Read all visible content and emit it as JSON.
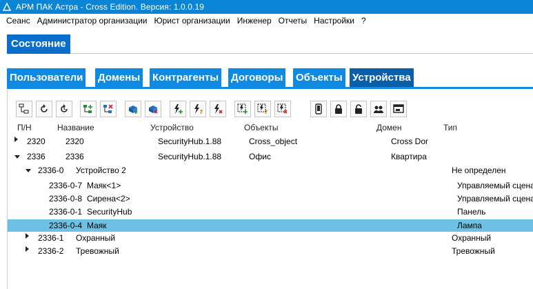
{
  "window": {
    "title": "АРМ ПАК Астра - Cross Edition. Версия: 1.0.0.19"
  },
  "menu": [
    "Сеанс",
    "Администратор организации",
    "Юрист организации",
    "Инженер",
    "Отчеты",
    "Настройки",
    "?"
  ],
  "status_tab": "Состояние",
  "tabs": [
    "Пользователи",
    "Домены",
    "Контрагенты",
    "Договоры",
    "Объекты",
    "Устройства"
  ],
  "active_tab": "Устройства",
  "columns": {
    "pn": "П/Н",
    "name": "Название",
    "device": "Устройство",
    "objects": "Объекты",
    "domain": "Домен",
    "type": "Тип"
  },
  "toolbar_icons": [
    "device-tree-icon",
    "refresh-icon",
    "refresh-timer-icon",
    "add-node-icon",
    "remove-node-icon",
    "add-device-icon",
    "remove-device-icon",
    "add-zone-icon",
    "edit-zone-icon",
    "remove-zone-icon",
    "add-sensor-icon",
    "edit-sensor-icon",
    "remove-sensor-icon",
    "phone-icon",
    "lock-icon",
    "unlock-icon",
    "users-icon",
    "console-icon"
  ],
  "rows": [
    {
      "pn": "2320",
      "name": "2320",
      "device": "SecurityHub.1.88",
      "objects": "Cross_object",
      "domain": "Cross Dom",
      "type": "",
      "expander": "right",
      "level": 0
    },
    {
      "pn": "2336",
      "name": "2336",
      "device": "SecurityHub.1.88",
      "objects": "Офис",
      "domain": "Квартира",
      "type": "",
      "expander": "down",
      "level": 0
    },
    {
      "pn": "2336-0",
      "name": "Устройство 2",
      "device": "",
      "objects": "",
      "domain": "",
      "type": "Не определен",
      "expander": "down",
      "level": 1
    },
    {
      "pn": "2336-0-7",
      "name": "Маяк<1>",
      "device": "",
      "objects": "",
      "domain": "",
      "type": "Управляемый сцена",
      "expander": "",
      "level": 2
    },
    {
      "pn": "2336-0-8",
      "name": "Сирена<2>",
      "device": "",
      "objects": "",
      "domain": "",
      "type": "Управляемый сцена",
      "expander": "",
      "level": 2
    },
    {
      "pn": "2336-0-1",
      "name": "SecurityHub",
      "device": "",
      "objects": "",
      "domain": "",
      "type": "Панель",
      "expander": "",
      "level": 2
    },
    {
      "pn": "2336-0-4",
      "name": "Маяк",
      "device": "",
      "objects": "",
      "domain": "",
      "type": "Лампа",
      "expander": "",
      "level": 2,
      "selected": true
    },
    {
      "pn": "2336-1",
      "name": "Охранный",
      "device": "",
      "objects": "",
      "domain": "",
      "type": "Охранный",
      "expander": "right",
      "level": 1
    },
    {
      "pn": "2336-2",
      "name": "Тревожный",
      "device": "",
      "objects": "",
      "domain": "",
      "type": "Тревожный",
      "expander": "right",
      "level": 1
    }
  ]
}
